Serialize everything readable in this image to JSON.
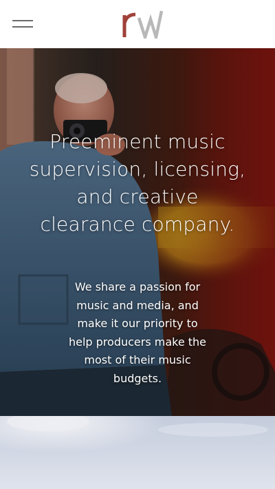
{
  "header": {
    "menu_icon": "hamburger-menu-icon",
    "logo_icon": "rw-logo",
    "logo_colors": {
      "r": "#a0403a",
      "w": "#b5b5b5"
    }
  },
  "hero": {
    "headline": "Preeminent music supervision, licensing, and creative clearance company.",
    "subtext": "We share a passion for music and media, and make it our priority to help producers make the most of their music budgets."
  }
}
